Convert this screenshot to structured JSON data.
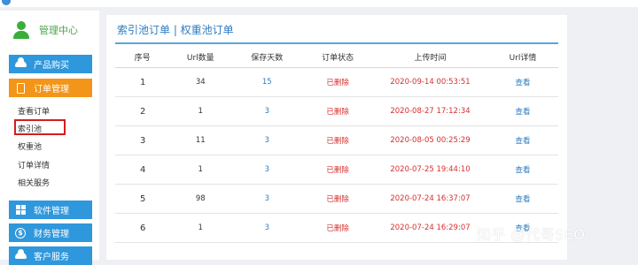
{
  "sidebar": {
    "admin_label": "管理中心",
    "menu": [
      {
        "label": "产品购买",
        "icon": "cloud-icon",
        "color": "#2f97dc"
      },
      {
        "label": "订单管理",
        "icon": "document-icon",
        "color": "#f29518"
      },
      {
        "label": "软件管理",
        "icon": "grid-icon",
        "color": "#2f97dc"
      },
      {
        "label": "财务管理",
        "icon": "dollar-icon",
        "color": "#2f97dc"
      },
      {
        "label": "客户服务",
        "icon": "cloud-icon",
        "color": "#2f97dc"
      }
    ],
    "sub_items": [
      "查看订单",
      "索引池",
      "权重池",
      "订单详情",
      "相关服务"
    ]
  },
  "main": {
    "title": "索引池订单 | 权重池订单",
    "table": {
      "headers": [
        "序号",
        "Url数量",
        "保存天数",
        "订单状态",
        "上传时间",
        "Url详情"
      ],
      "rows": [
        {
          "no": "1",
          "count": "34",
          "days": "15",
          "status": "已删除",
          "time": "2020-09-14 00:53:51",
          "detail": "查看"
        },
        {
          "no": "2",
          "count": "1",
          "days": "3",
          "status": "已删除",
          "time": "2020-08-27 17:12:34",
          "detail": "查看"
        },
        {
          "no": "3",
          "count": "11",
          "days": "3",
          "status": "已删除",
          "time": "2020-08-05 00:25:29",
          "detail": "查看"
        },
        {
          "no": "4",
          "count": "1",
          "days": "3",
          "status": "已删除",
          "time": "2020-07-25 19:44:10",
          "detail": "查看"
        },
        {
          "no": "5",
          "count": "98",
          "days": "3",
          "status": "已删除",
          "time": "2020-07-24 16:37:07",
          "detail": "查看"
        },
        {
          "no": "6",
          "count": "1",
          "days": "3",
          "status": "已删除",
          "time": "2020-07-24 16:29:07",
          "detail": "查看"
        }
      ]
    }
  },
  "watermark": "知乎 @代哥SEO"
}
